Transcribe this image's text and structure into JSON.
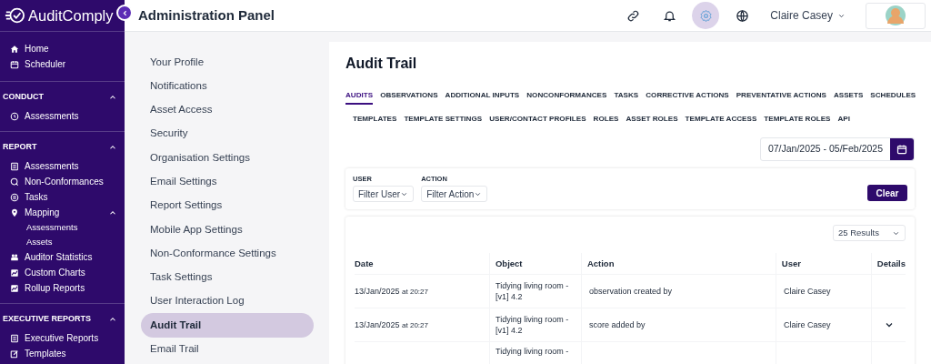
{
  "brand": "AuditComply",
  "header": {
    "title": "Administration Panel",
    "user": "Claire Casey"
  },
  "sidebar": {
    "top_items": [
      {
        "label": "Home"
      },
      {
        "label": "Scheduler"
      }
    ],
    "sections": [
      {
        "title": "CONDUCT",
        "expanded": true,
        "items": [
          {
            "label": "Assessments"
          }
        ]
      },
      {
        "title": "REPORT",
        "expanded": true,
        "items": [
          {
            "label": "Assessments"
          },
          {
            "label": "Non-Conformances"
          },
          {
            "label": "Tasks"
          },
          {
            "label": "Mapping",
            "expanded": true,
            "children": [
              {
                "label": "Assessments"
              },
              {
                "label": "Assets"
              }
            ]
          },
          {
            "label": "Auditor Statistics"
          },
          {
            "label": "Custom Charts"
          },
          {
            "label": "Rollup Reports"
          }
        ]
      },
      {
        "title": "EXECUTIVE REPORTS",
        "expanded": true,
        "items": [
          {
            "label": "Executive Reports"
          },
          {
            "label": "Templates"
          }
        ]
      }
    ]
  },
  "admin_menu": [
    {
      "label": "Your Profile",
      "selected": false
    },
    {
      "label": "Notifications",
      "selected": false
    },
    {
      "label": "Asset Access",
      "selected": false
    },
    {
      "label": "Security",
      "selected": false
    },
    {
      "label": "Organisation Settings",
      "selected": false
    },
    {
      "label": "Email Settings",
      "selected": false
    },
    {
      "label": "Report Settings",
      "selected": false
    },
    {
      "label": "Mobile App Settings",
      "selected": false
    },
    {
      "label": "Non-Conformance Settings",
      "selected": false
    },
    {
      "label": "Task Settings",
      "selected": false
    },
    {
      "label": "User Interaction Log",
      "selected": false
    },
    {
      "label": "Audit Trail",
      "selected": true
    },
    {
      "label": "Email Trail",
      "selected": false
    }
  ],
  "panel": {
    "title": "Audit Trail",
    "tabs": [
      [
        {
          "label": "AUDITS",
          "selected": true
        },
        {
          "label": "OBSERVATIONS",
          "selected": false
        },
        {
          "label": "ADDITIONAL INPUTS",
          "selected": false
        },
        {
          "label": "NONCONFORMANCES",
          "selected": false
        },
        {
          "label": "TASKS",
          "selected": false
        },
        {
          "label": "CORRECTIVE ACTIONS",
          "selected": false
        },
        {
          "label": "PREVENTATIVE ACTIONS",
          "selected": false
        },
        {
          "label": "ASSETS",
          "selected": false
        },
        {
          "label": "SCHEDULES",
          "selected": false
        }
      ],
      [
        {
          "label": "TEMPLATES",
          "selected": false
        },
        {
          "label": "TEMPLATE SETTINGS",
          "selected": false
        },
        {
          "label": "USER/CONTACT PROFILES",
          "selected": false
        },
        {
          "label": "ROLES",
          "selected": false
        },
        {
          "label": "ASSET ROLES",
          "selected": false
        },
        {
          "label": "TEMPLATE ACCESS",
          "selected": false
        },
        {
          "label": "TEMPLATE ROLES",
          "selected": false
        },
        {
          "label": "API",
          "selected": false
        }
      ]
    ],
    "date_range": "07/Jan/2025 - 05/Feb/2025",
    "filters": [
      {
        "label": "USER",
        "placeholder": "Filter User"
      },
      {
        "label": "ACTION",
        "placeholder": "Filter Action"
      }
    ],
    "clear_button": "Clear",
    "results": "25 Results",
    "table": {
      "columns": [
        "Date",
        "Object",
        "Action",
        "User",
        "Details"
      ],
      "rows": [
        {
          "date": "13/Jan/2025",
          "time": "at 20:27",
          "object": "Tidying living room - [v1] 4.2",
          "action": "observation created by",
          "user": "Claire Casey",
          "expandable": false
        },
        {
          "date": "13/Jan/2025",
          "time": "at 20:27",
          "object": "Tidying living room - [v1] 4.2",
          "action": "score added by",
          "user": "Claire Casey",
          "expandable": true
        },
        {
          "object": "Tidying living room -",
          "expandable": false
        }
      ]
    }
  }
}
